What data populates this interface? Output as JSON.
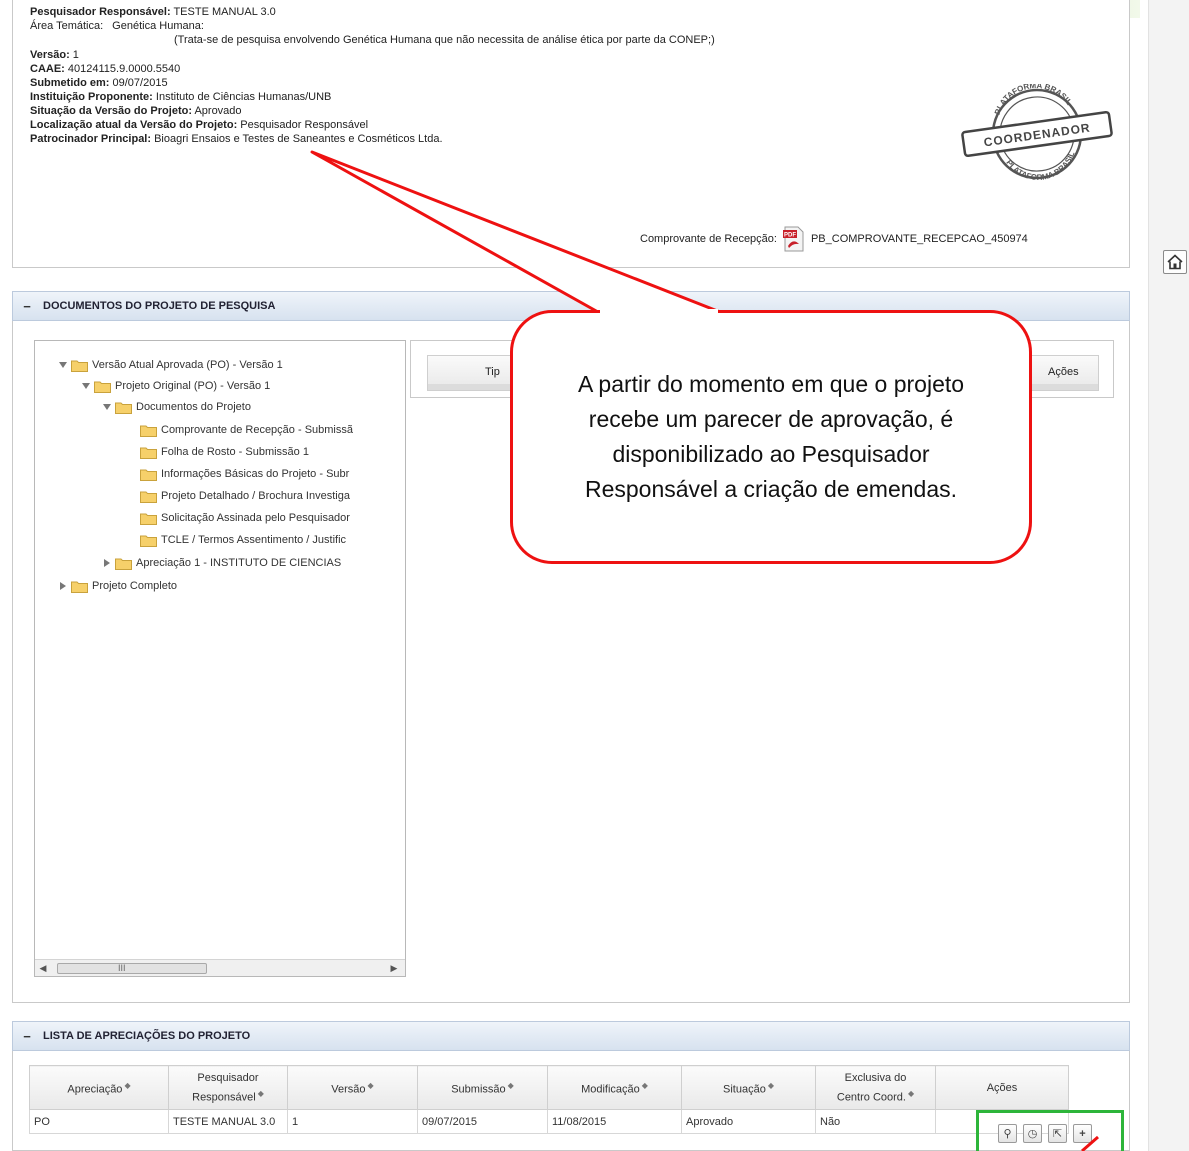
{
  "colors": {
    "callout_border": "#ee1111",
    "highlight": "#2db53a",
    "header_bg": "#d7e2ef"
  },
  "icons": [
    "pdf-icon",
    "home-icon",
    "folder-icon",
    "stamp-image",
    "search-icon",
    "history-icon",
    "open-icon",
    "plus-icon"
  ],
  "project": {
    "pesq_label": "Pesquisador Responsável:",
    "pesq_value": " TESTE MANUAL 3.0",
    "area_label": "Área Temática:",
    "area_value": "Genética Humana:",
    "area_note": "(Trata-se de pesquisa envolvendo Genética Humana que não necessita de análise ética por parte da CONEP;)",
    "versao_label": "Versão:",
    "versao_value": " 1",
    "caae_label": "CAAE:",
    "caae_value": " 40124115.9.0000.5540",
    "submetido_label": "Submetido em:",
    "submetido_value": " 09/07/2015",
    "instituicao_label": "Instituição Proponente:",
    "instituicao_value": " Instituto de Ciências Humanas/UNB",
    "situacao_label": "Situação da Versão do Projeto:",
    "situacao_value": " Aprovado",
    "localizacao_label": "Localização atual da Versão do Projeto:",
    "localizacao_value": " Pesquisador Responsável",
    "patrocinador_label": "Patrocinador Principal:",
    "patrocinador_value": " Bioagri Ensaios e Testes de Saneantes e Cosméticos Ltda.",
    "stamp": {
      "top": "PLATAFORMA BRASIL",
      "center": "COORDENADOR",
      "bottom": "PLATAFORMA BRASIL"
    },
    "receipt_label": "Comprovante de Recepção:",
    "receipt_file": "PB_COMPROVANTE_RECEPCAO_450974"
  },
  "documents_section": {
    "collapse": "−",
    "title": "DOCUMENTOS DO PROJETO DE PESQUISA",
    "tree": [
      "Versão Atual Aprovada (PO) - Versão 1",
      "Projeto Original (PO) - Versão 1",
      "Documentos do Projeto",
      "Comprovante de Recepção - Submissã",
      "Folha de Rosto - Submissão 1",
      "Informações Básicas do Projeto - Subr",
      "Projeto Detalhado / Brochura Investiga",
      "Solicitação Assinada pelo Pesquisador",
      "TCLE / Termos Assentimento / Justific",
      "Apreciação 1 - INSTITUTO DE CIENCIAS",
      "Projeto Completo"
    ],
    "scroll_grip": "III",
    "table_tipo": "Tip",
    "table_acoes": "Ações"
  },
  "appraisals_section": {
    "collapse": "−",
    "title": "LISTA DE APRECIAÇÕES DO PROJETO",
    "sort_glyph": "◆",
    "headers": {
      "apreciacao": "Apreciação",
      "pesquisador_1": "Pesquisador",
      "pesquisador_2": "Responsável",
      "versao": "Versão",
      "submissao": "Submissão",
      "modificacao": "Modificação",
      "situacao": "Situação",
      "exclusiva_1": "Exclusiva do",
      "exclusiva_2": "Centro Coord.",
      "acoes": "Ações"
    },
    "row": {
      "apreciacao": "PO",
      "pesquisador": "TESTE MANUAL 3.0",
      "versao": "1",
      "submissao": "09/07/2015",
      "modificacao": "11/08/2015",
      "situacao": "Aprovado",
      "exclusiva": "Não"
    },
    "action_glyphs": {
      "search": "⚲",
      "history": "◷",
      "open": "⇱",
      "plus": "+"
    }
  },
  "callout": {
    "text": "A partir do momento em que o projeto recebe um parecer de aprovação, é disponibilizado ao Pesquisador Responsável a criação de emendas."
  }
}
